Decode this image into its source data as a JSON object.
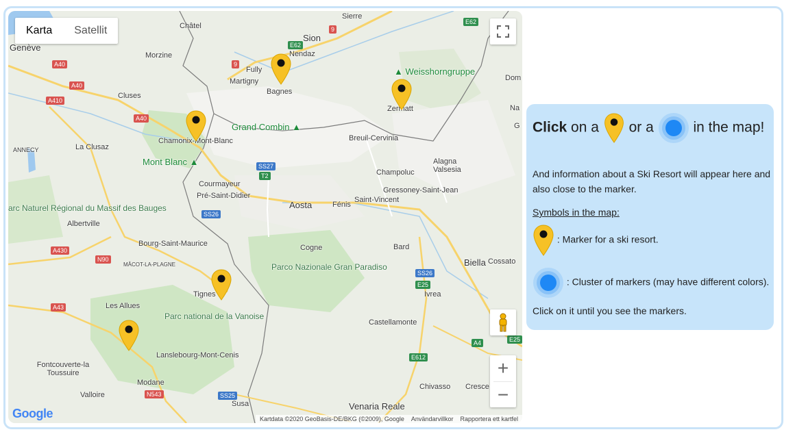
{
  "map": {
    "type_buttons": [
      {
        "label": "Karta",
        "active": true
      },
      {
        "label": "Satellit",
        "active": false
      }
    ],
    "labels": {
      "geneve": "Genève",
      "chatel": "Châtel",
      "sierre": "Sierre",
      "sion": "Sion",
      "nendaz": "Nendaz",
      "fully": "Fully",
      "martigny": "Martigny",
      "bagnes": "Bagnes",
      "morzine": "Morzine",
      "cluses": "Cluses",
      "weisshorn": "Weisshorngruppe",
      "zermatt": "Zermatt",
      "dom": "Dom",
      "na": "Na",
      "g": "G",
      "annecy": "ANNECY",
      "laclusaz": "La Clusaz",
      "chamonix": "Chamonix-Mont-Blanc",
      "grandcombin": "Grand Combin",
      "breuil": "Breuil-Cervinia",
      "montblanc": "Mont Blanc",
      "alagna": "Alagna Valsesia",
      "champoluc": "Champoluc",
      "courmayeur": "Courmayeur",
      "pre": "Pré-Saint-Didier",
      "gressoney": "Gressoney-Saint-Jean",
      "aosta": "Aosta",
      "fenis": "Fénis",
      "stvincent": "Saint-Vincent",
      "albertville": "Albertville",
      "bauges": "arc Naturel Régional du Massif des Bauges",
      "bourg": "Bourg-Saint-Maurice",
      "cogne": "Cogne",
      "bard": "Bard",
      "macot": "MÂCOT-LA-PLAGNE",
      "biella": "Biella",
      "cossato": "Cossato",
      "tignes": "Tignes",
      "paradiso": "Parco Nazionale Gran Paradiso",
      "ivrea": "Ivrea",
      "allues": "Les Allues",
      "vanoise": "Parc national de la Vanoise",
      "castellamonte": "Castellamonte",
      "lanslebourg": "Lanslebourg-Mont-Cenis",
      "fontcouverte": "Fontcouverte-la Toussuire",
      "modane": "Modane",
      "chivasso": "Chivasso",
      "cresce": "Cresce",
      "valloire": "Valloire",
      "susa": "Susa",
      "venaria": "Venaria Reale"
    },
    "shields": {
      "a40a": "A40",
      "a40b": "A40",
      "a40c": "A40",
      "a410": "A410",
      "e62a": "E62",
      "e62b": "E62",
      "r9a": "9",
      "r9b": "9",
      "ss27": "SS27",
      "t2": "T2",
      "ss26a": "SS26",
      "ss26b": "SS26",
      "a430": "A430",
      "n90": "N90",
      "e25a": "E25",
      "e25b": "E25",
      "a43": "A43",
      "a4": "A4",
      "e612": "E612",
      "n543": "N543",
      "ss25": "SS25"
    },
    "attribution": [
      "Kartdata ©2020 GeoBasis-DE/BKG (©2009), Google",
      "Användarvillkor",
      "Rapportera ett kartfel"
    ],
    "google_logo": "Google"
  },
  "info": {
    "click": "Click",
    "on_a": " on a ",
    "or_a": " or a ",
    "in_the_map": " in the map!",
    "description": "And information about a Ski Resort will appear here and also close to the marker.",
    "symbols_heading": "Symbols in the map:",
    "marker_desc": ": Marker for a ski resort.",
    "cluster_desc": ": Cluster of markers (may have different colors). Click on it until you see the markers."
  },
  "colors": {
    "marker": "#f6c126",
    "cluster": "#1e88f5",
    "panel": "#c7e4fa",
    "frame": "#c9e3f8"
  }
}
